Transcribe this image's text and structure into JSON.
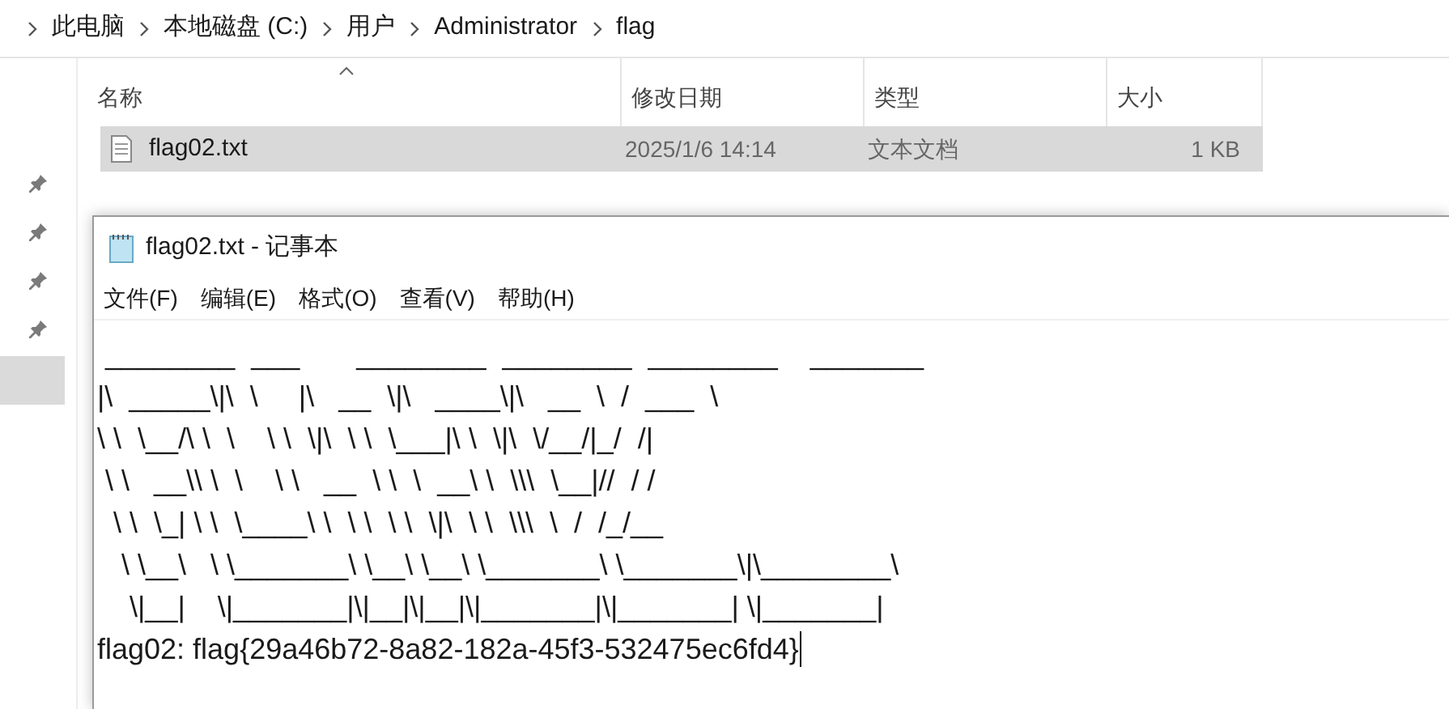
{
  "breadcrumb": [
    "此电脑",
    "本地磁盘 (C:)",
    "用户",
    "Administrator",
    "flag"
  ],
  "columns": [
    {
      "label": "名称",
      "sorted": true
    },
    {
      "label": "修改日期",
      "sorted": false
    },
    {
      "label": "类型",
      "sorted": false
    },
    {
      "label": "大小",
      "sorted": false
    }
  ],
  "files": [
    {
      "name": "flag02.txt",
      "modified": "2025/1/6 14:14",
      "type": "文本文档",
      "size": "1 KB",
      "selected": true
    }
  ],
  "notepad": {
    "title": "flag02.txt - 记事本",
    "menu": [
      "文件(F)",
      "编辑(E)",
      "格式(O)",
      "查看(V)",
      "帮助(H)"
    ],
    "art_lines": [
      " ________  ___       ________  ________  ________    _______",
      "|\\  _____\\|\\  \\     |\\   __  \\|\\   ____\\|\\   __  \\  /  ___  \\",
      "\\ \\  \\__/\\ \\  \\    \\ \\  \\|\\  \\ \\  \\___|\\ \\  \\|\\  \\/__/|_/  /|",
      " \\ \\   __\\\\ \\  \\    \\ \\   __  \\ \\  \\  __\\ \\  \\\\\\  \\__|//  / /",
      "  \\ \\  \\_| \\ \\  \\____\\ \\  \\ \\  \\ \\  \\|\\  \\ \\  \\\\\\  \\  /  /_/__",
      "   \\ \\__\\   \\ \\_______\\ \\__\\ \\__\\ \\_______\\ \\_______\\|\\________\\",
      "    \\|__|    \\|_______|\\|__|\\|__|\\|_______|\\|_______| \\|_______|"
    ],
    "text": "flag02: flag{29a46b72-8a82-182a-45f3-532475ec6fd4}"
  }
}
